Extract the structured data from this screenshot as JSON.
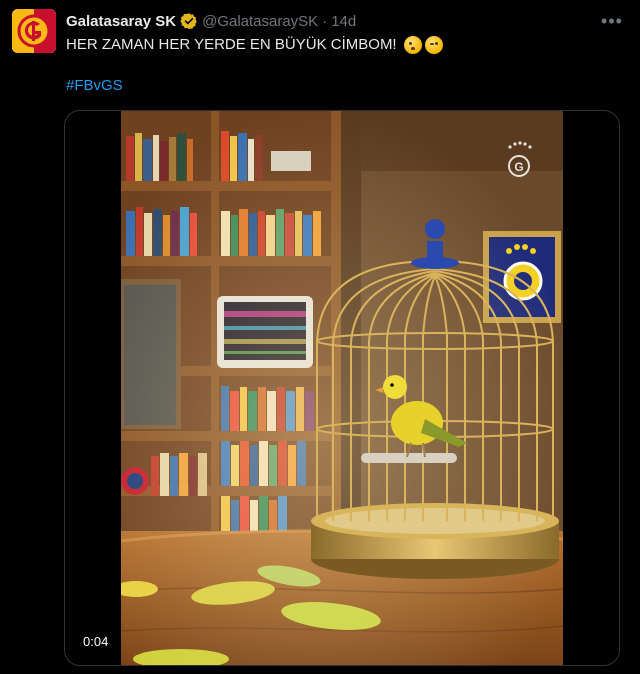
{
  "post": {
    "author_name": "Galatasaray SK",
    "handle": "@GalatasaraySK",
    "separator": "·",
    "time": "14d",
    "more_label": "•••",
    "text": "HER ZAMAN HER YERDE EN BÜYÜK CİMBOM!",
    "emojis": [
      "kissing-face-emoji",
      "winking-face-emoji"
    ],
    "hashtag": "#FBvGS"
  },
  "video": {
    "timestamp": "0:04"
  },
  "colors": {
    "background": "#000000",
    "primary_text": "#e7e9ea",
    "secondary_text": "#71767b",
    "link": "#1d9bf0",
    "border": "#2f3336",
    "galatasaray_red": "#c8102e",
    "galatasaray_yellow": "#fdb913"
  }
}
